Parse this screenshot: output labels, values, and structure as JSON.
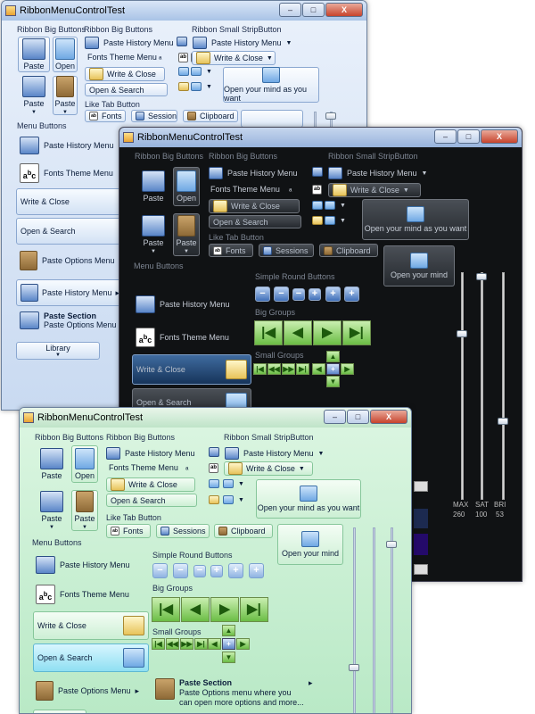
{
  "window_title": "RibbonMenuControlTest",
  "controls": {
    "minimize": "–",
    "maximize": "□",
    "close": "X"
  },
  "sections": {
    "ribbon_big_buttons": "Ribbon Big Buttons",
    "ribbon_small_strip": "Ribbon Small StripButton",
    "like_tab": "Like Tab Button",
    "menu_buttons": "Menu Buttons",
    "simple_round": "Simple Round Buttons",
    "big_groups": "Big Groups",
    "small_groups": "Small Groups"
  },
  "labels": {
    "paste": "Paste",
    "open": "Open",
    "paste_history_menu": "Paste History Menu",
    "fonts_theme_menu": "Fonts Theme Menu",
    "write_close": "Write & Close",
    "open_search": "Open & Search",
    "open_your_mind_as_you_want": "Open your mind as you want",
    "open_your_mind": "Open your mind",
    "fonts": "Fonts",
    "sessions": "Sessions",
    "clipboard": "Clipboard",
    "paste_options_menu": "Paste Options Menu",
    "paste_section": "Paste Section",
    "paste_section_sub_w1": "Paste Options Menu",
    "paste_section_sub_w3": "Paste Options menu where you can open more options and more...",
    "library": "Library"
  },
  "slider_readout": {
    "row1": [
      "MAX",
      "SAT",
      "BRI"
    ],
    "row2": [
      "260",
      "100",
      "53"
    ]
  }
}
